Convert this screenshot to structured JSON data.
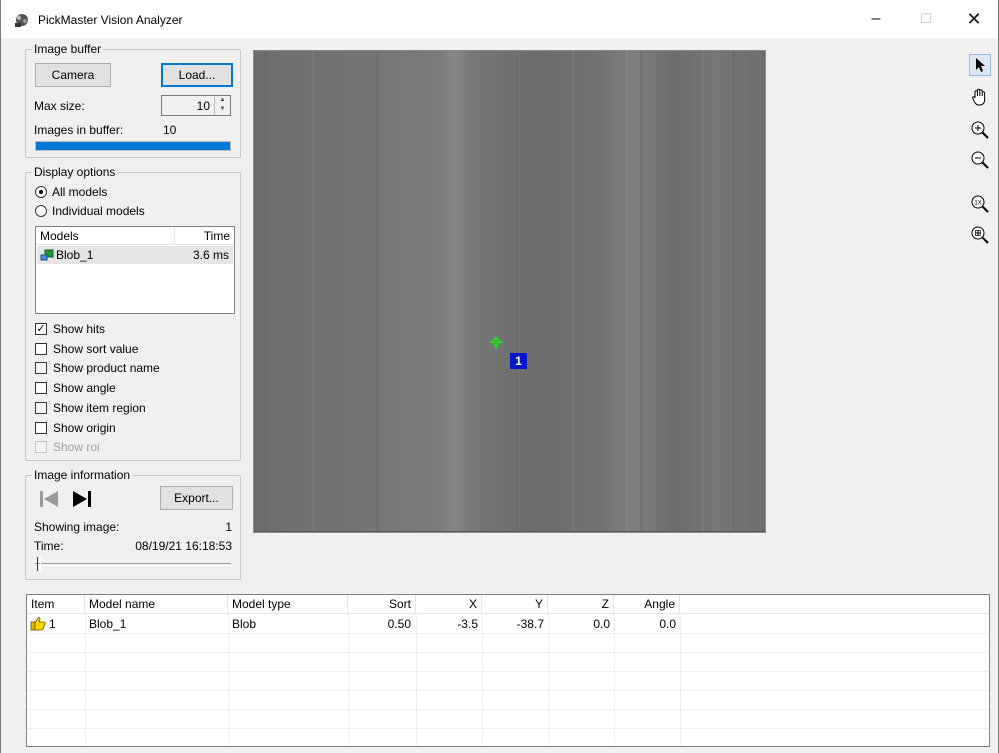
{
  "window": {
    "title": "PickMaster Vision Analyzer",
    "minimize": "–",
    "maximize": "☐",
    "close": "✕"
  },
  "image_buffer": {
    "legend": "Image buffer",
    "camera_label": "Camera",
    "load_label": "Load...",
    "max_size_label": "Max size:",
    "max_size_value": "10",
    "images_in_buffer_label": "Images in buffer:",
    "images_in_buffer_value": "10",
    "buffer_fill_fraction": 1.0
  },
  "display_options": {
    "legend": "Display options",
    "radio_all": "All models",
    "radio_individual": "Individual models",
    "models_table": {
      "col_models": "Models",
      "col_time": "Time",
      "rows": [
        {
          "name": "Blob_1",
          "time": "3.6 ms"
        }
      ]
    },
    "checkboxes": [
      {
        "label": "Show hits",
        "checked": true,
        "enabled": true
      },
      {
        "label": "Show sort value",
        "checked": false,
        "enabled": true
      },
      {
        "label": "Show product name",
        "checked": false,
        "enabled": true
      },
      {
        "label": "Show angle",
        "checked": false,
        "enabled": true
      },
      {
        "label": "Show item region",
        "checked": false,
        "enabled": true
      },
      {
        "label": "Show origin",
        "checked": false,
        "enabled": true
      },
      {
        "label": "Show roi",
        "checked": false,
        "enabled": false
      }
    ]
  },
  "image_information": {
    "legend": "Image information",
    "export_label": "Export...",
    "showing_label": "Showing image:",
    "showing_value": "1",
    "time_label": "Time:",
    "time_value": "08/19/21 16:18:53",
    "slider_fraction": 0.0
  },
  "image_view": {
    "marker_label": "1"
  },
  "results": {
    "columns": [
      "Item",
      "Model name",
      "Model type",
      "Sort",
      "X",
      "Y",
      "Z",
      "Angle"
    ],
    "rows": [
      {
        "item": "1",
        "model_name": "Blob_1",
        "model_type": "Blob",
        "sort": "0.50",
        "x": "-3.5",
        "y": "-38.7",
        "z": "0.0",
        "angle": "0.0"
      }
    ]
  },
  "colors": {
    "accent": "#0078d7",
    "marker": "#0018c8",
    "crosshair": "#22dd22"
  }
}
